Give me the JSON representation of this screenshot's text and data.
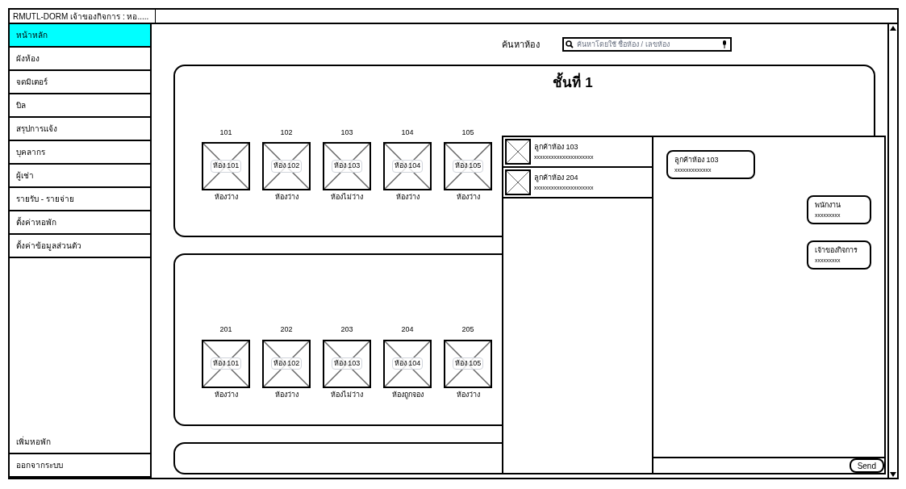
{
  "window": {
    "title": "RMUTL-DORM เจ้าของกิจการ : หอ....."
  },
  "sidebar": {
    "items": [
      {
        "label": "หน้าหลัก",
        "selected": true
      },
      {
        "label": "ผังห้อง",
        "selected": false
      },
      {
        "label": "จดมิเตอร์",
        "selected": false
      },
      {
        "label": "บิล",
        "selected": false
      },
      {
        "label": "สรุปการแจ้ง",
        "selected": false
      },
      {
        "label": "บุคลากร",
        "selected": false
      },
      {
        "label": "ผู้เช่า",
        "selected": false
      },
      {
        "label": "รายรับ - รายจ่าย",
        "selected": false
      },
      {
        "label": "ตั้งค่าหอพัก",
        "selected": false
      },
      {
        "label": "ตั้งค่าข้อมูลส่วนตัว",
        "selected": false
      }
    ],
    "bottom_items": [
      {
        "label": "เพิ่มหอพัก",
        "selected": false
      },
      {
        "label": "ออกจากระบบ",
        "selected": false
      }
    ]
  },
  "search": {
    "label": "ค้นหาห้อง",
    "placeholder": "ค้นหาโดยใช้ ชื่อห้อง / เลขห้อง"
  },
  "floors": [
    {
      "title": "ชั้นที่ 1",
      "rooms": [
        {
          "number": "101",
          "caption": "ห้อง 101",
          "status": "ห้องว่าง"
        },
        {
          "number": "102",
          "caption": "ห้อง 102",
          "status": "ห้องว่าง"
        },
        {
          "number": "103",
          "caption": "ห้อง 103",
          "status": "ห้องไม่ว่าง"
        },
        {
          "number": "104",
          "caption": "ห้อง 104",
          "status": "ห้องว่าง"
        },
        {
          "number": "105",
          "caption": "ห้อง 105",
          "status": "ห้องว่าง"
        }
      ]
    },
    {
      "rooms": [
        {
          "number": "201",
          "caption": "ห้อง 101",
          "status": "ห้องว่าง"
        },
        {
          "number": "202",
          "caption": "ห้อง 102",
          "status": "ห้องว่าง"
        },
        {
          "number": "203",
          "caption": "ห้อง 103",
          "status": "ห้องไม่ว่าง"
        },
        {
          "number": "204",
          "caption": "ห้อง 104",
          "status": "ห้องถูกจอง"
        },
        {
          "number": "205",
          "caption": "ห้อง 105",
          "status": "ห้องว่าง"
        }
      ]
    }
  ],
  "chat": {
    "conversations": [
      {
        "name": "ลูกค้าห้อง 103",
        "preview": "xxxxxxxxxxxxxxxxxxxxx"
      },
      {
        "name": "ลูกค้าห้อง 204",
        "preview": "xxxxxxxxxxxxxxxxxxxxx"
      }
    ],
    "messages": [
      {
        "kind": "incoming",
        "sender": "ลูกค้าห้อง 103",
        "text": "xxxxxxxxxxxxx"
      },
      {
        "kind": "outgoing",
        "sender": "พนักงาน",
        "text": "xxxxxxxxx"
      },
      {
        "kind": "outgoing",
        "sender": "เจ้าของกิจการ",
        "text": "xxxxxxxxx"
      }
    ],
    "send_button": "Send"
  }
}
